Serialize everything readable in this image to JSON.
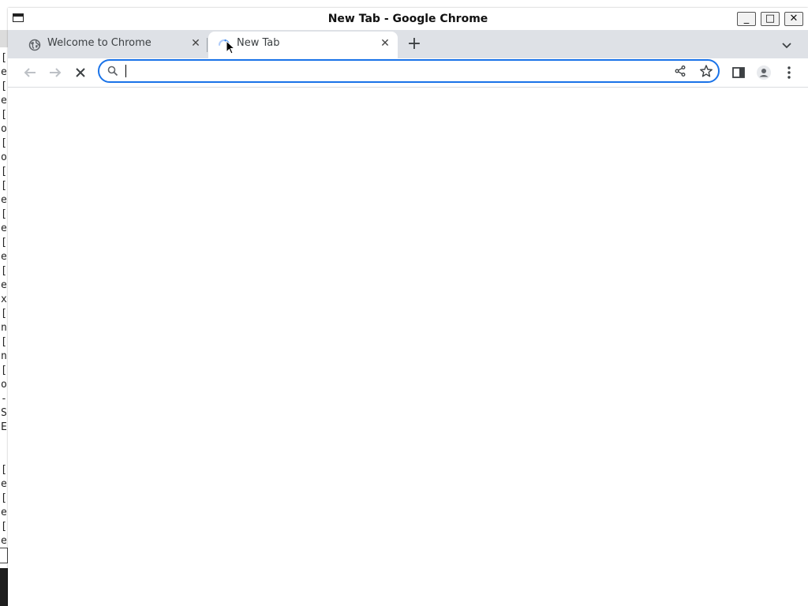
{
  "window": {
    "title": "New Tab - Google Chrome",
    "controls": {
      "minimize": "_",
      "maximize": "□",
      "close": "✕"
    }
  },
  "tabs": [
    {
      "title": "Welcome to Chrome",
      "icon": "globe-icon",
      "active": false,
      "close": "✕"
    },
    {
      "title": "New Tab",
      "icon": "loading-spinner-icon",
      "active": true,
      "close": "✕"
    }
  ],
  "tab_strip": {
    "new_tab": "+"
  },
  "toolbar": {
    "back_enabled": false,
    "forward_enabled": false,
    "stop_visible": true
  },
  "omnibox": {
    "value": "",
    "placeholder": "",
    "focused": true
  },
  "background_terminal": {
    "lines_top": [
      "[",
      "e",
      "[",
      "e",
      "[",
      "o",
      "[",
      "o",
      "[",
      "[",
      "e",
      "[",
      "e",
      "[",
      "e",
      "[",
      "e",
      "x",
      "[",
      "n",
      "[",
      "n",
      "[",
      "o",
      "-",
      "S",
      "E"
    ],
    "lines_bottom": [
      "[",
      "e",
      "[",
      "e",
      "[",
      "e"
    ]
  },
  "colors": {
    "accent": "#1a73e8",
    "tab_strip": "#dee1e6",
    "icon": "#5f6368",
    "disabled_icon": "#bdc1c6"
  }
}
